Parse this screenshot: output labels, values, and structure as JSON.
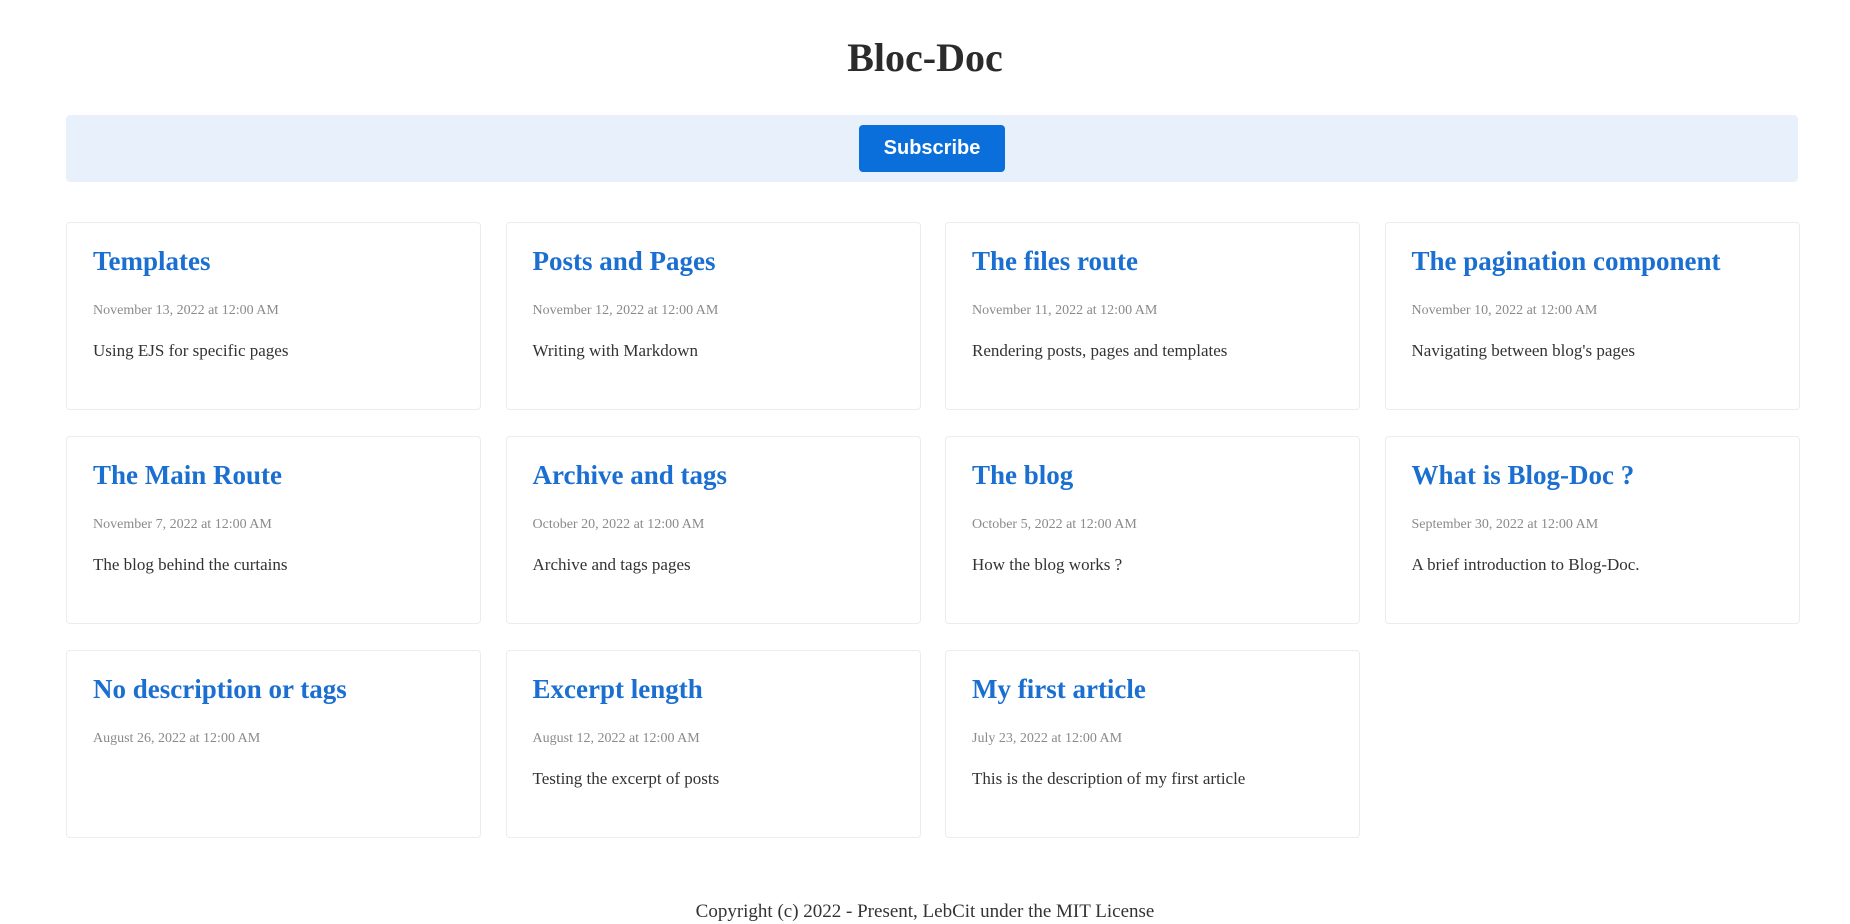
{
  "site": {
    "title": "Bloc-Doc"
  },
  "subscribe": {
    "label": "Subscribe"
  },
  "colors": {
    "accent": "#0a6fdb",
    "title_link": "#1a6fd0",
    "banner_bg": "#e8f1fb"
  },
  "posts": [
    {
      "title": "Templates",
      "date": "November 13, 2022 at 12:00 AM",
      "description": "Using EJS for specific pages"
    },
    {
      "title": "Posts and Pages",
      "date": "November 12, 2022 at 12:00 AM",
      "description": "Writing with Markdown"
    },
    {
      "title": "The files route",
      "date": "November 11, 2022 at 12:00 AM",
      "description": "Rendering posts, pages and templates"
    },
    {
      "title": "The pagination component",
      "date": "November 10, 2022 at 12:00 AM",
      "description": "Navigating between blog's pages"
    },
    {
      "title": "The Main Route",
      "date": "November 7, 2022 at 12:00 AM",
      "description": "The blog behind the curtains"
    },
    {
      "title": "Archive and tags",
      "date": "October 20, 2022 at 12:00 AM",
      "description": "Archive and tags pages"
    },
    {
      "title": "The blog",
      "date": "October 5, 2022 at 12:00 AM",
      "description": "How the blog works ?"
    },
    {
      "title": "What is Blog-Doc ?",
      "date": "September 30, 2022 at 12:00 AM",
      "description": "A brief introduction to Blog-Doc."
    },
    {
      "title": "No description or tags",
      "date": "August 26, 2022 at 12:00 AM",
      "description": ""
    },
    {
      "title": "Excerpt length",
      "date": "August 12, 2022 at 12:00 AM",
      "description": "Testing the excerpt of posts"
    },
    {
      "title": "My first article",
      "date": "July 23, 2022 at 12:00 AM",
      "description": "This is the description of my first article"
    }
  ],
  "footer": {
    "text": "Copyright (c) 2022 - Present, LebCit under the MIT License"
  }
}
